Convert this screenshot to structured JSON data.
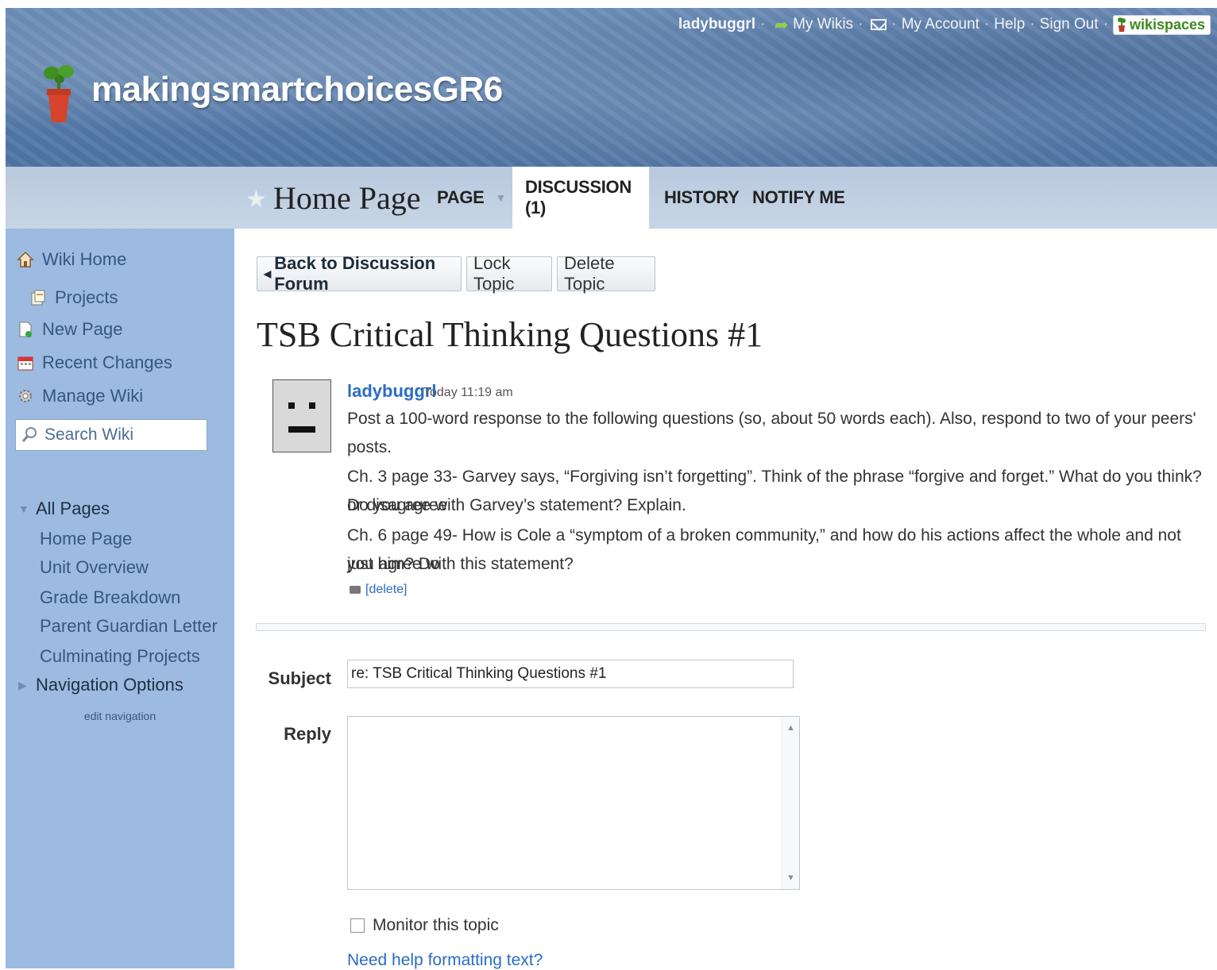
{
  "header": {
    "site_title": "makingsmartchoicesGR6",
    "top_links": {
      "username": "ladybuggrl",
      "my_wikis": "My Wikis",
      "my_account": "My Account",
      "help": "Help",
      "sign_out": "Sign Out",
      "brand": "wikispaces"
    }
  },
  "tabs": {
    "page_title": "Home Page",
    "page": "PAGE",
    "discussion": "DISCUSSION (1)",
    "history": "HISTORY",
    "notify": "NOTIFY ME"
  },
  "sidebar": {
    "wiki_home": "Wiki Home",
    "projects": "Projects",
    "new_page": "New Page",
    "recent_changes": "Recent Changes",
    "manage_wiki": "Manage Wiki",
    "search_placeholder": "Search Wiki",
    "all_pages": "All Pages",
    "pages": [
      "Home Page",
      "Unit Overview",
      "Grade Breakdown",
      "Parent Guardian Letter",
      "Culminating Projects"
    ],
    "navigation_options": "Navigation Options",
    "edit_navigation": "edit navigation"
  },
  "toolbar": {
    "back": "Back to Discussion Forum",
    "lock": "Lock Topic",
    "delete": "Delete Topic"
  },
  "topic": {
    "title": "TSB Critical Thinking Questions #1",
    "author": "ladybuggrl",
    "time": "Today 11:19 am",
    "line1": "Post a 100-word response to the following questions (so, about 50 words each). Also, respond to two of your peers' posts.",
    "line2": "Ch. 3 page 33- Garvey says, “Forgiving isn’t forgetting”. Think of the phrase “forgive and forget.” What do you think? Do you agree",
    "line3": "or disagree with Garvey’s statement? Explain.",
    "line4": "Ch. 6 page 49- How is Cole a “symptom of a broken community,” and how do his actions affect the whole and not just him? Do",
    "line5": "you agree with this statement?",
    "delete_link": "[delete]"
  },
  "form": {
    "subject_label": "Subject",
    "subject_value": "re: TSB Critical Thinking Questions #1",
    "reply_label": "Reply",
    "monitor_label": "Monitor this topic",
    "help_link": "Need help formatting text?"
  }
}
